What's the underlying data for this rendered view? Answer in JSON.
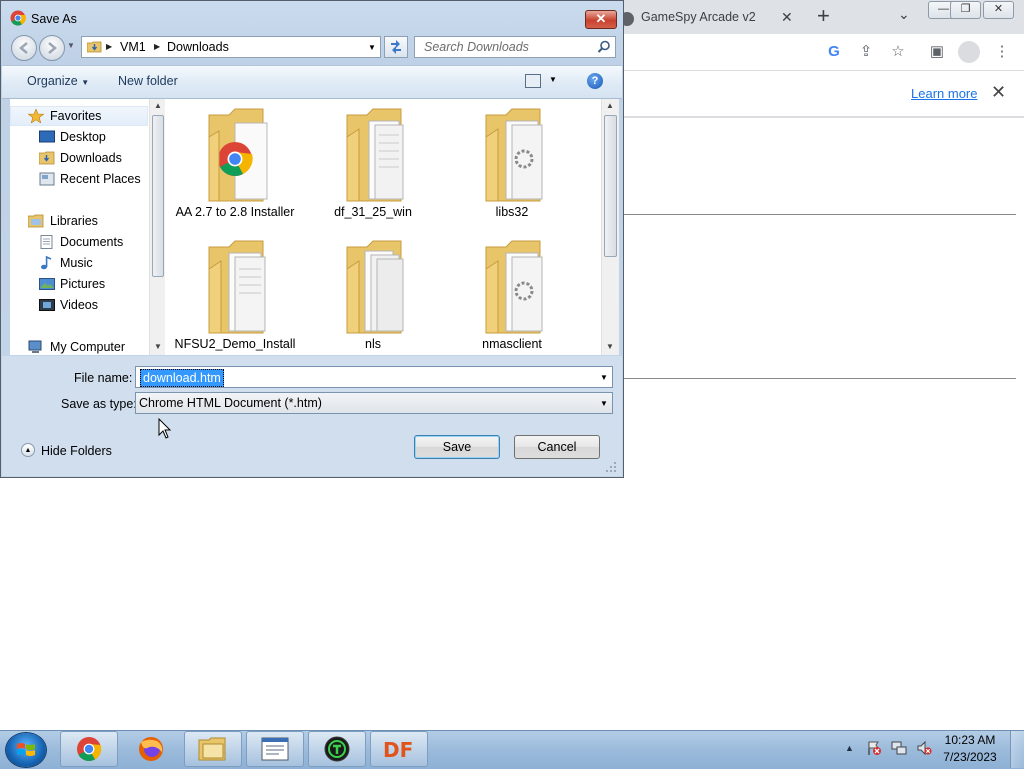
{
  "browser": {
    "tab_title": "GameSpy Arcade v2",
    "tab_close": "✕",
    "new_tab": "+",
    "infobar_link": "Learn more",
    "infobar_close": "✕"
  },
  "dialog": {
    "title": "Save As",
    "close_glyph": "✕",
    "breadcrumb": [
      "VM1",
      "Downloads"
    ],
    "search_placeholder": "Search Downloads",
    "toolbar": {
      "organize": "Organize",
      "new_folder": "New folder",
      "help": "?"
    },
    "nav": {
      "favorites": "Favorites",
      "desktop": "Desktop",
      "downloads": "Downloads",
      "recent_places": "Recent Places",
      "libraries": "Libraries",
      "documents": "Documents",
      "music": "Music",
      "pictures": "Pictures",
      "videos": "Videos",
      "my_computer": "My Computer"
    },
    "files": [
      {
        "name": "AA 2.7 to 2.8 Installer",
        "icon": "chrome-folder-icon"
      },
      {
        "name": "df_31_25_win",
        "icon": "folder-icon"
      },
      {
        "name": "libs32",
        "icon": "folder-icon"
      },
      {
        "name": "NFSU2_Demo_Install",
        "icon": "folder-icon"
      },
      {
        "name": "nls",
        "icon": "folder-icon"
      },
      {
        "name": "nmasclient",
        "icon": "folder-icon"
      }
    ],
    "file_name_label": "File name:",
    "file_name_value": "download.htm",
    "save_type_label": "Save as type:",
    "save_type_value": "Chrome HTML Document (*.htm)",
    "hide_folders": "Hide Folders",
    "save_button": "Save",
    "cancel_button": "Cancel"
  },
  "taskbar": {
    "apps": [
      "chrome",
      "firefox",
      "windows-explorer",
      "document-viewer",
      "game-app",
      "df-app"
    ],
    "df_label": "DF",
    "time": "10:23 AM",
    "date": "7/23/2023"
  },
  "colors": {
    "dialog_frame": "#c4d5e8",
    "selection": "#3399ff",
    "link": "#1a73e8",
    "taskbar": "#9dbcdc"
  }
}
